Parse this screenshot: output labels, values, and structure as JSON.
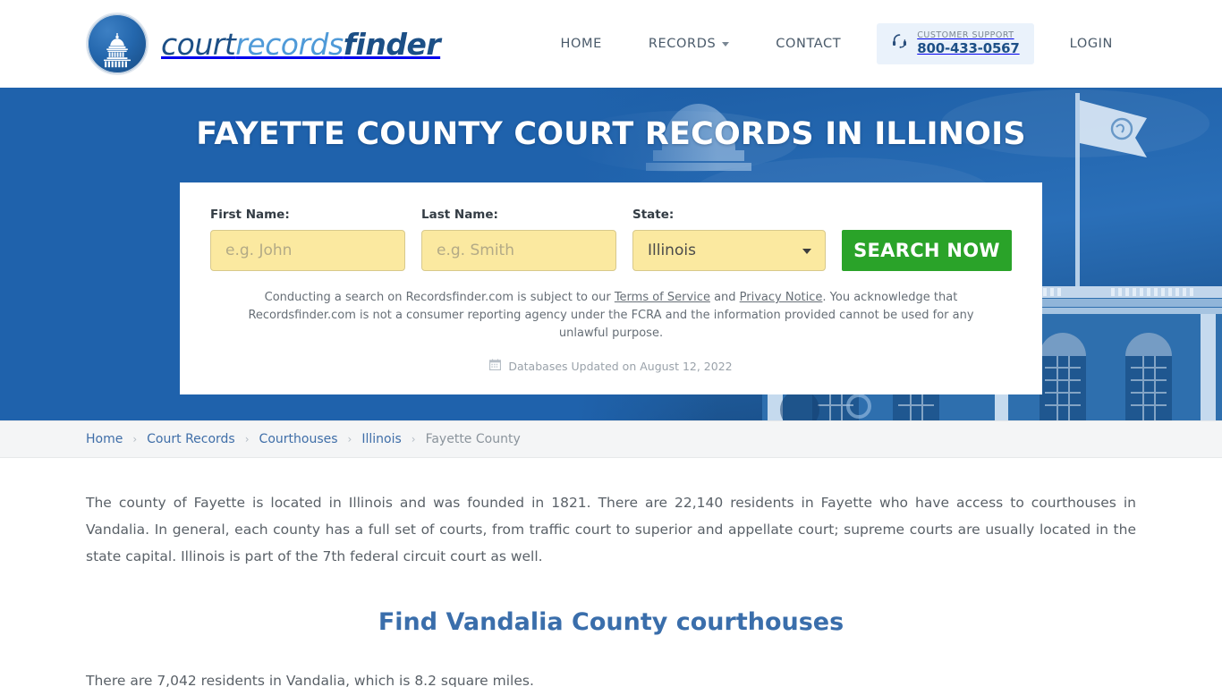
{
  "header": {
    "logo": {
      "icon": "capitol-dome-icon",
      "part1": "court",
      "part2": "records",
      "part3": "finder"
    },
    "nav": [
      {
        "label": "HOME",
        "has_caret": false
      },
      {
        "label": "RECORDS",
        "has_caret": true
      },
      {
        "label": "CONTACT",
        "has_caret": false
      }
    ],
    "support": {
      "icon": "headset-icon",
      "label": "CUSTOMER SUPPORT",
      "phone": "800-433-0567"
    },
    "login_label": "LOGIN"
  },
  "hero": {
    "title": "FAYETTE COUNTY COURT RECORDS IN ILLINOIS",
    "background_color": "#1f62ac",
    "form": {
      "first_name": {
        "label": "First Name:",
        "placeholder": "e.g. John",
        "value": ""
      },
      "last_name": {
        "label": "Last Name:",
        "placeholder": "e.g. Smith",
        "value": ""
      },
      "state": {
        "label": "State:",
        "selected": "Illinois",
        "options": [
          "Illinois"
        ]
      },
      "submit_label": "SEARCH NOW",
      "submit_color": "#2aa329"
    },
    "disclaimer": {
      "part1": "Conducting a search on Recordsfinder.com is subject to our ",
      "link1": "Terms of Service",
      "mid": " and ",
      "link2": "Privacy Notice",
      "part2": ". You acknowledge that Recordsfinder.com is not a consumer reporting agency under the FCRA and the information provided cannot be used for any unlawful purpose."
    },
    "updated": {
      "icon": "calendar-icon",
      "text": "Databases Updated on August 12, 2022"
    }
  },
  "breadcrumb": {
    "items": [
      {
        "label": "Home",
        "current": false
      },
      {
        "label": "Court Records",
        "current": false
      },
      {
        "label": "Courthouses",
        "current": false
      },
      {
        "label": "Illinois",
        "current": false
      },
      {
        "label": "Fayette County",
        "current": true
      }
    ],
    "separator": "›"
  },
  "content": {
    "intro": "The county of Fayette is located in Illinois and was founded in 1821. There are 22,140 residents in Fayette who have access to courthouses in Vandalia. In general, each county has a full set of courts, from traffic court to superior and appellate court; supreme courts are usually located in the state capital. Illinois is part of the 7th federal circuit court as well.",
    "section_heading": "Find Vandalia County courthouses",
    "section_para": "There are 7,042 residents in Vandalia, which is 8.2 square miles."
  }
}
